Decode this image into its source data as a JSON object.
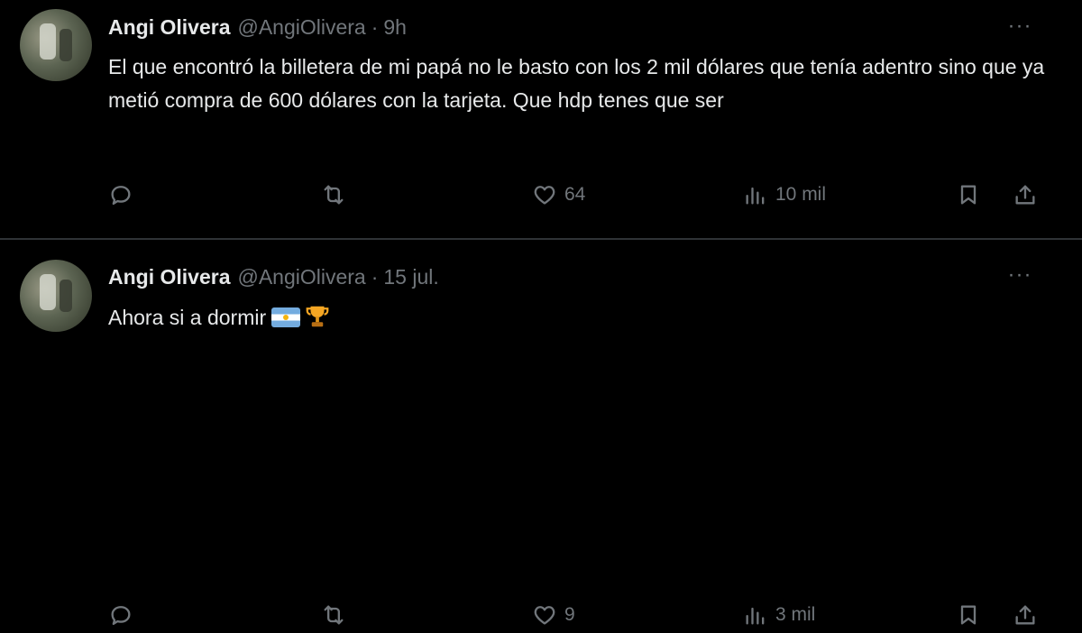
{
  "tweets": [
    {
      "name": "Angi Olivera",
      "handle": "@AngiOlivera",
      "separator": "·",
      "time": "9h",
      "text": "El que encontró la billetera de mi papá no le basto con los 2 mil dólares que tenía adentro sino que ya metió compra de 600 dólares con la tarjeta. Que hdp tenes que ser",
      "likes": "64",
      "views": "10 mil",
      "more": "···"
    },
    {
      "name": "Angi Olivera",
      "handle": "@AngiOlivera",
      "separator": "·",
      "time": "15 jul.",
      "text": "Ahora si a dormir",
      "emojis": [
        "argentina-flag",
        "trophy"
      ],
      "likes": "9",
      "views": "3 mil",
      "more": "···"
    }
  ],
  "colors": {
    "background": "#000000",
    "text": "#e7e9ea",
    "secondary": "#71767b",
    "divider": "#2f3336"
  }
}
